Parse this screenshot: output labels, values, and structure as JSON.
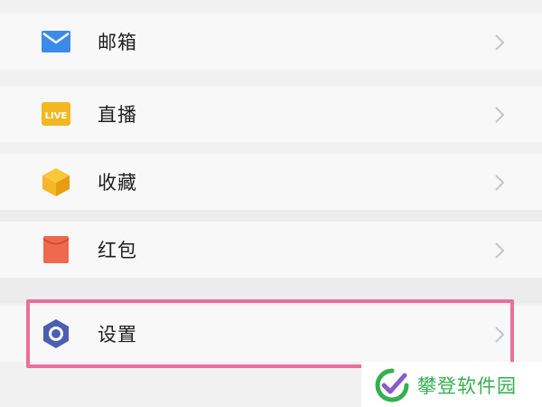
{
  "menu": {
    "items": [
      {
        "label": "邮箱",
        "icon": "mail-icon",
        "color": "#3d8be8"
      },
      {
        "label": "直播",
        "icon": "live-icon",
        "color": "#f2b822",
        "badge": "LIVE"
      },
      {
        "label": "收藏",
        "icon": "favorites-cube-icon",
        "color": "#f6b62a"
      },
      {
        "label": "红包",
        "icon": "red-packet-icon",
        "color": "#f0684e"
      },
      {
        "label": "设置",
        "icon": "settings-hexagon-icon",
        "color": "#4b5fb0"
      }
    ]
  },
  "highlight": {
    "color": "#e8709a",
    "target": "设置"
  },
  "watermark": {
    "text": "攀登软件园",
    "color": "#34b04e"
  }
}
